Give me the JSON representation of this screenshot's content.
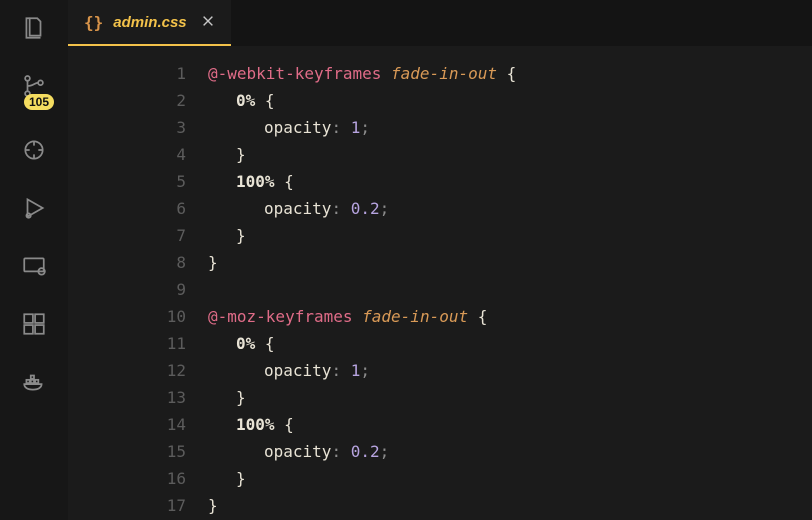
{
  "activityBar": {
    "badge": "105",
    "icons": [
      "files-icon",
      "source-control-icon",
      "git-branch-lens-icon",
      "run-debug-icon",
      "remote-explorer-icon",
      "extensions-icon",
      "docker-icon"
    ]
  },
  "tab": {
    "iconLabel": "{}",
    "title": "admin.css",
    "closeTooltip": "Close"
  },
  "gutter": {
    "start": 1,
    "end": 17
  },
  "code": {
    "lines": [
      {
        "n": 1,
        "ind": 0,
        "t": [
          [
            "kw",
            "@-webkit-keyframes"
          ],
          [
            "sp",
            " "
          ],
          [
            "ident",
            "fade-in-out"
          ],
          [
            "sp",
            " "
          ],
          [
            "brace",
            "{"
          ]
        ]
      },
      {
        "n": 2,
        "ind": 1,
        "t": [
          [
            "sel",
            "0%"
          ],
          [
            "sp",
            " "
          ],
          [
            "brace",
            "{"
          ]
        ]
      },
      {
        "n": 3,
        "ind": 2,
        "t": [
          [
            "prop",
            "opacity"
          ],
          [
            "punct",
            ":"
          ],
          [
            "sp",
            " "
          ],
          [
            "num",
            "1"
          ],
          [
            "punct",
            ";"
          ]
        ]
      },
      {
        "n": 4,
        "ind": 1,
        "t": [
          [
            "brace",
            "}"
          ]
        ]
      },
      {
        "n": 5,
        "ind": 1,
        "t": [
          [
            "sel",
            "100%"
          ],
          [
            "sp",
            " "
          ],
          [
            "brace",
            "{"
          ]
        ]
      },
      {
        "n": 6,
        "ind": 2,
        "t": [
          [
            "prop",
            "opacity"
          ],
          [
            "punct",
            ":"
          ],
          [
            "sp",
            " "
          ],
          [
            "num",
            "0.2"
          ],
          [
            "punct",
            ";"
          ]
        ]
      },
      {
        "n": 7,
        "ind": 1,
        "t": [
          [
            "brace",
            "}"
          ]
        ]
      },
      {
        "n": 8,
        "ind": 0,
        "t": [
          [
            "brace",
            "}"
          ]
        ]
      },
      {
        "n": 9,
        "ind": 0,
        "t": []
      },
      {
        "n": 10,
        "ind": 0,
        "t": [
          [
            "kw",
            "@-moz-keyframes"
          ],
          [
            "sp",
            " "
          ],
          [
            "ident",
            "fade-in-out"
          ],
          [
            "sp",
            " "
          ],
          [
            "brace",
            "{"
          ]
        ]
      },
      {
        "n": 11,
        "ind": 1,
        "t": [
          [
            "sel",
            "0%"
          ],
          [
            "sp",
            " "
          ],
          [
            "brace",
            "{"
          ]
        ]
      },
      {
        "n": 12,
        "ind": 2,
        "t": [
          [
            "prop",
            "opacity"
          ],
          [
            "punct",
            ":"
          ],
          [
            "sp",
            " "
          ],
          [
            "num",
            "1"
          ],
          [
            "punct",
            ";"
          ]
        ]
      },
      {
        "n": 13,
        "ind": 1,
        "t": [
          [
            "brace",
            "}"
          ]
        ]
      },
      {
        "n": 14,
        "ind": 1,
        "t": [
          [
            "sel",
            "100%"
          ],
          [
            "sp",
            " "
          ],
          [
            "brace",
            "{"
          ]
        ]
      },
      {
        "n": 15,
        "ind": 2,
        "t": [
          [
            "prop",
            "opacity"
          ],
          [
            "punct",
            ":"
          ],
          [
            "sp",
            " "
          ],
          [
            "num",
            "0.2"
          ],
          [
            "punct",
            ";"
          ]
        ]
      },
      {
        "n": 16,
        "ind": 1,
        "t": [
          [
            "brace",
            "}"
          ]
        ]
      },
      {
        "n": 17,
        "ind": 0,
        "t": [
          [
            "brace",
            "}"
          ]
        ]
      }
    ]
  }
}
